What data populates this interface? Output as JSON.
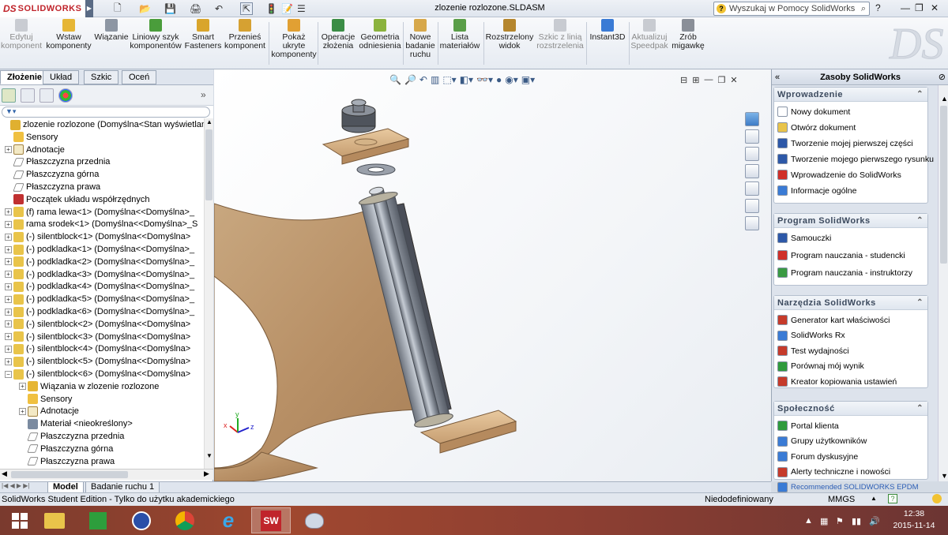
{
  "app": {
    "logo_prefix": "DS",
    "logo_text": "SOLIDWORKS",
    "doc_title": "zlozenie rozlozone.SLDASM",
    "search_placeholder": "Wyszukaj w Pomocy SolidWorks",
    "help": "?",
    "minimize": "—",
    "restore": "❐",
    "close": "✕"
  },
  "quick_access": {
    "new": "🗋",
    "open": "📂",
    "save": "💾",
    "print": "🖨",
    "undo": "↶",
    "select": "⇱",
    "rebuild": "🚦",
    "file_props": "📝",
    "options": "☰"
  },
  "ribbon": [
    {
      "label": "Edytuj\nkomponent",
      "disabled": true
    },
    {
      "label": "Wstaw\nkomponenty",
      "disabled": false
    },
    {
      "label": "Wiązanie",
      "disabled": false
    },
    {
      "label": "Liniowy szyk\nkomponentów",
      "disabled": false
    },
    {
      "label": "Smart\nFasteners",
      "disabled": false
    },
    {
      "label": "Przenieś\nkomponent",
      "disabled": false
    },
    {
      "label": "Pokaż\nukryte\nkomponenty",
      "disabled": false
    },
    {
      "label": "Operacje\nzłożenia",
      "disabled": false
    },
    {
      "label": "Geometria\nodniesienia",
      "disabled": false
    },
    {
      "label": "Nowe\nbadanie\nruchu",
      "disabled": false
    },
    {
      "label": "Lista\nmateriałów",
      "disabled": false
    },
    {
      "label": "Rozstrzelony\nwidok",
      "disabled": false
    },
    {
      "label": "Szkic z linią\nrozstrzelenia",
      "disabled": true
    },
    {
      "label": "Instant3D",
      "disabled": false
    },
    {
      "label": "Aktualizuj\nSpeedpak",
      "disabled": true
    },
    {
      "label": "Zrób\nmigawkę",
      "disabled": false
    }
  ],
  "left_tabs": [
    "Złożenie",
    "Układ",
    "Szkic",
    "Oceń"
  ],
  "tree": [
    {
      "label": "zlozenie rozlozone  (Domyślna<Stan wyświetlan",
      "indent": 0,
      "exp": "",
      "icon": "assembly"
    },
    {
      "label": "Sensory",
      "indent": 1,
      "exp": "",
      "icon": "sensor"
    },
    {
      "label": "Adnotacje",
      "indent": 1,
      "exp": "+",
      "icon": "annot"
    },
    {
      "label": "Płaszczyzna przednia",
      "indent": 1,
      "exp": "",
      "icon": "plane"
    },
    {
      "label": "Płaszczyzna górna",
      "indent": 1,
      "exp": "",
      "icon": "plane"
    },
    {
      "label": "Płaszczyzna prawa",
      "indent": 1,
      "exp": "",
      "icon": "plane"
    },
    {
      "label": "Początek układu współrzędnych",
      "indent": 1,
      "exp": "",
      "icon": "origin"
    },
    {
      "label": "(f) rama lewa<1> (Domyślna<<Domyślna>_",
      "indent": 1,
      "exp": "+",
      "icon": "part"
    },
    {
      "label": "rama srodek<1> (Domyślna<<Domyślna>_S",
      "indent": 1,
      "exp": "+",
      "icon": "part"
    },
    {
      "label": "(-) silentblock<1> (Domyślna<<Domyślna>",
      "indent": 1,
      "exp": "+",
      "icon": "part"
    },
    {
      "label": "(-) podkladka<1> (Domyślna<<Domyślna>_",
      "indent": 1,
      "exp": "+",
      "icon": "part"
    },
    {
      "label": "(-) podkladka<2> (Domyślna<<Domyślna>_",
      "indent": 1,
      "exp": "+",
      "icon": "part"
    },
    {
      "label": "(-) podkladka<3> (Domyślna<<Domyślna>_",
      "indent": 1,
      "exp": "+",
      "icon": "part"
    },
    {
      "label": "(-) podkladka<4> (Domyślna<<Domyślna>_",
      "indent": 1,
      "exp": "+",
      "icon": "part"
    },
    {
      "label": "(-) podkladka<5> (Domyślna<<Domyślna>_",
      "indent": 1,
      "exp": "+",
      "icon": "part"
    },
    {
      "label": "(-) podkladka<6> (Domyślna<<Domyślna>_",
      "indent": 1,
      "exp": "+",
      "icon": "part"
    },
    {
      "label": "(-) silentblock<2> (Domyślna<<Domyślna>",
      "indent": 1,
      "exp": "+",
      "icon": "part"
    },
    {
      "label": "(-) silentblock<3> (Domyślna<<Domyślna>",
      "indent": 1,
      "exp": "+",
      "icon": "part"
    },
    {
      "label": "(-) silentblock<4> (Domyślna<<Domyślna>",
      "indent": 1,
      "exp": "+",
      "icon": "part"
    },
    {
      "label": "(-) silentblock<5> (Domyślna<<Domyślna>",
      "indent": 1,
      "exp": "+",
      "icon": "part"
    },
    {
      "label": "(-) silentblock<6> (Domyślna<<Domyślna>",
      "indent": 1,
      "exp": "−",
      "icon": "part"
    },
    {
      "label": "Wiązania w zlozenie rozlozone",
      "indent": 2,
      "exp": "+",
      "icon": "mates"
    },
    {
      "label": "Sensory",
      "indent": 2,
      "exp": "",
      "icon": "sensor"
    },
    {
      "label": "Adnotacje",
      "indent": 2,
      "exp": "+",
      "icon": "annot"
    },
    {
      "label": "Materiał <nieokreślony>",
      "indent": 2,
      "exp": "",
      "icon": "material"
    },
    {
      "label": "Płaszczyzna przednia",
      "indent": 2,
      "exp": "",
      "icon": "plane"
    },
    {
      "label": "Płaszczyzna górna",
      "indent": 2,
      "exp": "",
      "icon": "plane"
    },
    {
      "label": "Płaszczyzna prawa",
      "indent": 2,
      "exp": "",
      "icon": "plane"
    }
  ],
  "bottom_tabs": [
    "Model",
    "Badanie ruchu 1"
  ],
  "status": {
    "left": "SolidWorks Student Edition - Tylko do użytku akademickiego",
    "mid": "Niedodefiniowany",
    "units": "MMGS",
    "up": "▲",
    "help": "?"
  },
  "right": {
    "title": "Zasoby SolidWorks",
    "panels": [
      {
        "title": "Wprowadzenie",
        "items": [
          {
            "label": "Nowy dokument",
            "color": "#ffffff"
          },
          {
            "label": "Otwórz dokument",
            "color": "#e9c44a"
          },
          {
            "label": "Tworzenie mojej pierwszej części",
            "color": "#2d58a8"
          },
          {
            "label": "Tworzenie mojego pierwszego rysunku",
            "color": "#2d58a8"
          },
          {
            "label": "Wprowadzenie do SolidWorks",
            "color": "#d0302a"
          },
          {
            "label": "Informacje ogólne",
            "color": "#3a7bd5"
          }
        ]
      },
      {
        "title": "Program SolidWorks",
        "items": [
          {
            "label": "Samouczki",
            "color": "#2d58a8"
          },
          {
            "label": "Program nauczania - studencki",
            "color": "#d0302a"
          },
          {
            "label": "Program nauczania - instruktorzy",
            "color": "#3a9a43"
          }
        ]
      },
      {
        "title": "Narzędzia SolidWorks",
        "items": [
          {
            "label": "Generator kart właściwości",
            "color": "#c63b2b"
          },
          {
            "label": "SolidWorks Rx",
            "color": "#3a7bd5"
          },
          {
            "label": "Test wydajności",
            "color": "#c63b2b"
          },
          {
            "label": "Porównaj mój wynik",
            "color": "#2f9b3d"
          },
          {
            "label": "Kreator kopiowania ustawień",
            "color": "#c63b2b"
          }
        ]
      },
      {
        "title": "Społeczność",
        "items": [
          {
            "label": "Portal klienta",
            "color": "#2f9b3d"
          },
          {
            "label": "Grupy użytkowników",
            "color": "#3a7bd5"
          },
          {
            "label": "Forum dyskusyjne",
            "color": "#3a7bd5"
          },
          {
            "label": "Alerty techniczne i nowości",
            "color": "#c63b2b"
          },
          {
            "label": "Recommended SOLIDWORKS EPDM",
            "color": "#3a7bd5"
          }
        ]
      }
    ]
  },
  "taskbar": {
    "time": "12:38",
    "date": "2015-11-14",
    "apps": [
      "start",
      "explorer",
      "store",
      "settings",
      "chrome",
      "ie",
      "solidworks",
      "paint"
    ]
  },
  "triad": {
    "x": "x",
    "y": "y",
    "z": "z"
  }
}
